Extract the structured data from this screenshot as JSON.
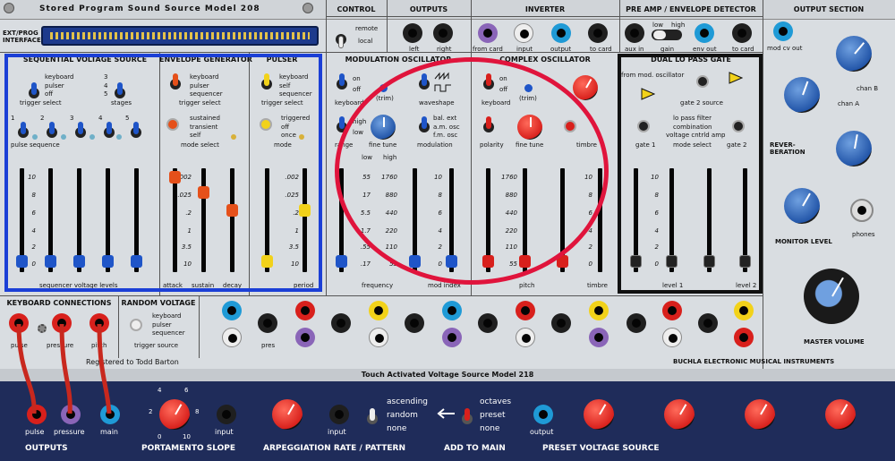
{
  "top": {
    "title": "Stored Program Sound Source Model 208",
    "ext_prog_label": "EXT/PROG INTERFACE",
    "control_header": "CONTROL",
    "control_remote": "remote",
    "control_local": "local",
    "outputs_header": "OUTPUTS",
    "outputs_left": "left",
    "outputs_right": "right",
    "inverter_header": "INVERTER",
    "inverter_from_card": "from card",
    "inverter_input": "input",
    "inverter_output": "output",
    "inverter_to_card": "to card",
    "preamp_header": "PRE AMP / ENVELOPE DETECTOR",
    "preamp_low": "low",
    "preamp_high": "high",
    "preamp_aux_in": "aux in",
    "preamp_gain": "gain",
    "preamp_env_out": "env out",
    "preamp_to_card": "to card",
    "output_section_header": "OUTPUT SECTION",
    "mod_cv_out": "mod cv out",
    "chan_b": "chan B",
    "chan_a": "chan A",
    "reverberation": "REVER-\nBERATION",
    "monitor_level": "MONITOR LEVEL",
    "phones": "phones",
    "master_volume": "MASTER VOLUME"
  },
  "seq": {
    "header": "SEQUENTIAL VOLTAGE SOURCE",
    "trigger_opts": [
      "keyboard",
      "pulser",
      "off"
    ],
    "trigger_select": "trigger select",
    "stages_opts": [
      "3",
      "4",
      "5"
    ],
    "stages": "stages",
    "step_numbers": [
      "1",
      "2",
      "3",
      "4",
      "5"
    ],
    "pulse_sequence": "pulse sequence",
    "scale": [
      "10",
      "8",
      "6",
      "4",
      "2",
      "0"
    ],
    "footer": "sequencer voltage levels",
    "slider_levels": [
      0,
      0,
      0,
      0,
      0
    ]
  },
  "env": {
    "header": "ENVELOPE GENERATOR",
    "trigger_opts": [
      "keyboard",
      "pulser",
      "sequencer"
    ],
    "trigger_select": "trigger select",
    "mode_opts": [
      "sustained",
      "transient",
      "self"
    ],
    "mode_select": "mode select",
    "scale": [
      ".002",
      ".025",
      ".2",
      "1",
      "3.5",
      "10"
    ],
    "attack": "attack",
    "sustain": "sustain",
    "decay": "decay"
  },
  "pulser": {
    "header": "PULSER",
    "trigger_opts": [
      "keyboard",
      "self",
      "sequencer"
    ],
    "trigger_select": "trigger select",
    "mode_opts": [
      "triggered",
      "off",
      "once"
    ],
    "mode": "mode",
    "scale": [
      ".002",
      ".025",
      ".2",
      "1",
      "3.5",
      "10"
    ],
    "period": "period"
  },
  "modosc": {
    "header": "MODULATION OSCILLATOR",
    "kbd_opts": [
      "on",
      "off"
    ],
    "keyboard": "keyboard",
    "range_opts": [
      "high",
      "low"
    ],
    "range": "range",
    "trim": "(trim)",
    "fine_tune": "fine tune",
    "waveshape": "waveshape",
    "mod_opts": [
      "bal. ext",
      "a.m. osc",
      "f.m. osc"
    ],
    "modulation": "modulation",
    "freq_low": "low",
    "freq_high": "high",
    "scale_low": [
      "55",
      "17",
      "5.5",
      "1.7",
      ".55",
      ".17"
    ],
    "scale_high": [
      "1760",
      "880",
      "440",
      "220",
      "110",
      "55"
    ],
    "frequency": "frequency",
    "mod_scale": [
      "10",
      "8",
      "6",
      "4",
      "2",
      "0"
    ],
    "mod_index": "mod index"
  },
  "cplxosc": {
    "header": "COMPLEX OSCILLATOR",
    "kbd_opts": [
      "on",
      "off"
    ],
    "keyboard": "keyboard",
    "trim": "(trim)",
    "polarity": "polarity",
    "fine_tune": "fine tune",
    "timbre": "timbre",
    "pitch_scale": [
      "1760",
      "880",
      "440",
      "220",
      "110",
      "55"
    ],
    "pitch": "pitch",
    "timbre_scale": [
      "10",
      "8",
      "6",
      "4",
      "2",
      "0"
    ],
    "timbre_label": "timbre"
  },
  "dual": {
    "header": "DUAL LO PASS GATE",
    "from_mod": "from mod. oscillator",
    "gate2_source": "gate 2 source",
    "lo_pass": "lo pass filter",
    "combination": "combination",
    "vca": "voltage cntrld amp",
    "gate1": "gate 1",
    "mode_select": "mode select",
    "gate2": "gate 2",
    "scale": [
      "10",
      "8",
      "6",
      "4",
      "2",
      "0"
    ],
    "level1": "level 1",
    "level2": "level 2"
  },
  "kbd_conn": {
    "header": "KEYBOARD CONNECTIONS",
    "pulse": "pulse",
    "pressure": "pressure",
    "pitch": "pitch"
  },
  "random": {
    "header": "RANDOM VOLTAGE",
    "opts": [
      "keyboard",
      "pulser",
      "sequencer"
    ],
    "trigger_source": "trigger source",
    "pres": "pres"
  },
  "registered": "Registered to Todd Barton",
  "brand": "BUCHLA ELECTRONIC MUSICAL INSTRUMENTS",
  "bottom": {
    "title": "Touch Activated Voltage Source Model 218",
    "pulse": "pulse",
    "pressure": "pressure",
    "main": "main",
    "outputs": "OUTPUTS",
    "portamento": "PORTAMENTO SLOPE",
    "input1": "input",
    "arp_opts": [
      "ascending",
      "random",
      "none"
    ],
    "arpeggiation": "ARPEGGIATION RATE / PATTERN",
    "input2": "input",
    "add_opts": [
      "octaves",
      "preset",
      "none"
    ],
    "add_to_main": "ADD TO MAIN",
    "output": "output",
    "preset_voltage": "PRESET VOLTAGE SOURCE",
    "knob_marks": [
      "4",
      "6",
      "2",
      "8",
      "0",
      "10"
    ]
  },
  "colors": {
    "blue_highlight": "#1b3fd6",
    "red_circle": "#e0143c",
    "black_box": "#111111",
    "slider_blue": "#1f55c8",
    "slider_red": "#d8201c",
    "slider_orange": "#e5501a",
    "slider_yellow": "#f2d21a",
    "slider_black": "#222222"
  }
}
